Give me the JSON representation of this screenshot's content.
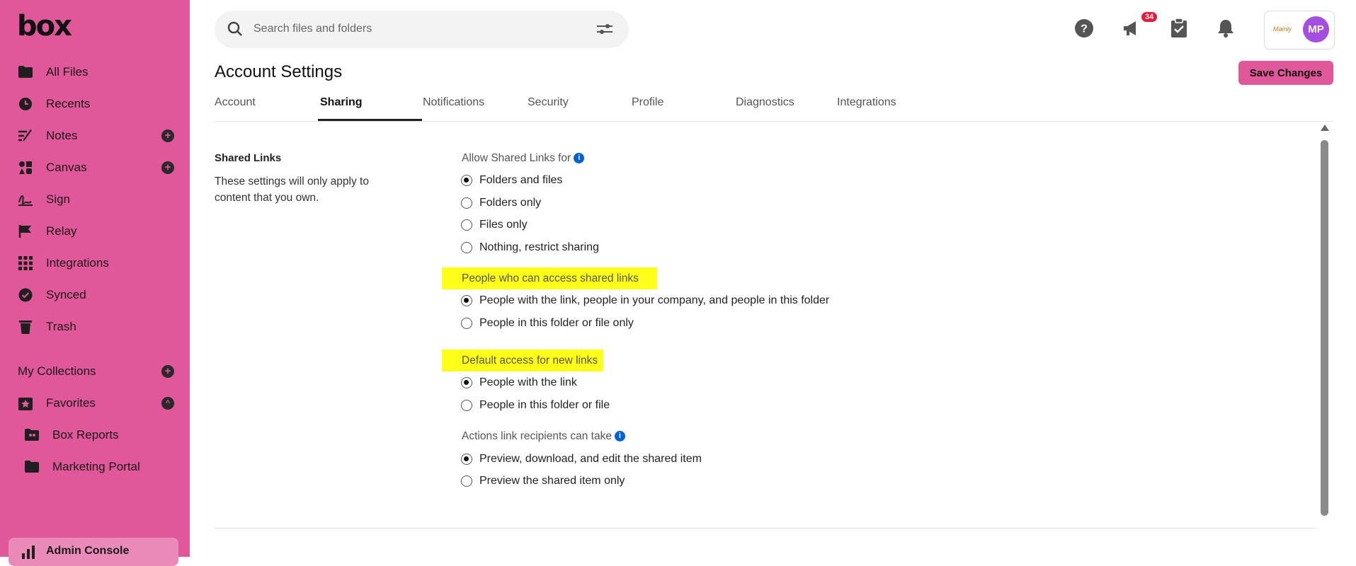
{
  "brand": {
    "logo": "box",
    "accent": "#e0579a"
  },
  "sidebar": {
    "items": [
      {
        "label": "All Files",
        "icon": "folder-icon"
      },
      {
        "label": "Recents",
        "icon": "clock-icon"
      },
      {
        "label": "Notes",
        "icon": "notes-icon",
        "add": "+"
      },
      {
        "label": "Canvas",
        "icon": "canvas-icon",
        "add": "+"
      },
      {
        "label": "Sign",
        "icon": "sign-icon"
      },
      {
        "label": "Relay",
        "icon": "relay-icon"
      },
      {
        "label": "Integrations",
        "icon": "grid-icon"
      },
      {
        "label": "Synced",
        "icon": "check-circle-icon"
      },
      {
        "label": "Trash",
        "icon": "trash-icon"
      }
    ],
    "collections_label": "My Collections",
    "collections_add": "+",
    "favorites_label": "Favorites",
    "favorites_toggle": "^",
    "favorites": [
      {
        "label": "Box Reports",
        "icon": "shared-folder-icon"
      },
      {
        "label": "Marketing Portal",
        "icon": "folder-icon"
      }
    ],
    "admin_label": "Admin Console"
  },
  "header": {
    "search_placeholder": "Search files and folders",
    "notifications_badge": "34",
    "enterprise_logo_text": "Mainly",
    "avatar_initials": "MP"
  },
  "page": {
    "title": "Account Settings",
    "save_label": "Save Changes",
    "tabs": [
      "Account",
      "Sharing",
      "Notifications",
      "Security",
      "Profile",
      "Diagnostics",
      "Integrations"
    ],
    "active_tab": "Sharing"
  },
  "shared_links": {
    "section_title": "Shared Links",
    "section_desc": "These settings will only apply to content that you own.",
    "info_glyph": "i",
    "allow": {
      "label": "Allow Shared Links for",
      "options": [
        "Folders and files",
        "Folders only",
        "Files only",
        "Nothing, restrict sharing"
      ],
      "selected": 0
    },
    "access": {
      "label": "People who can access shared links",
      "options": [
        "People with the link, people in your company, and people in this folder",
        "People in this folder or file only"
      ],
      "selected": 0
    },
    "default_access": {
      "label": "Default access for new links",
      "options": [
        "People with the link",
        "People in this folder or file"
      ],
      "selected": 0
    },
    "actions": {
      "label": "Actions link recipients can take",
      "options": [
        "Preview, download, and edit the shared item",
        "Preview the shared item only"
      ],
      "selected": 0
    }
  }
}
